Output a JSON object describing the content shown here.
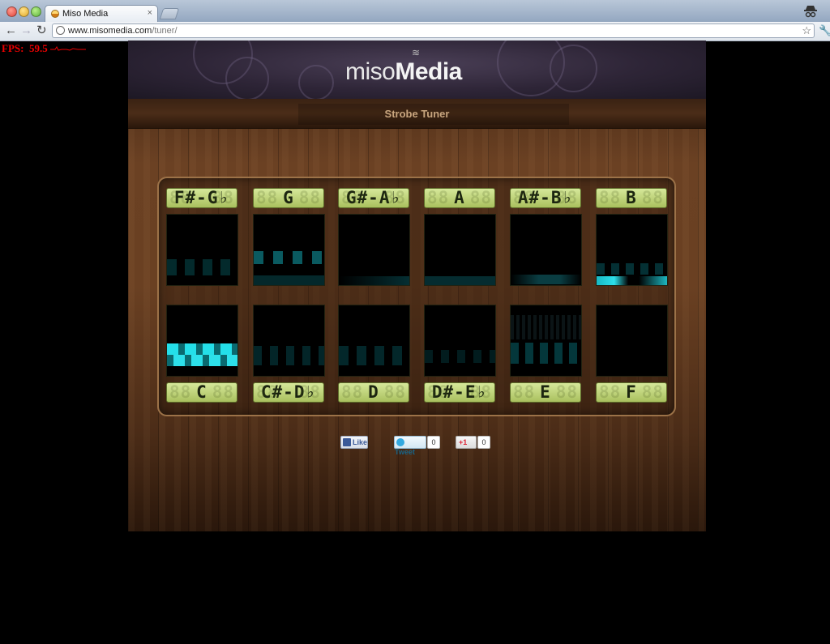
{
  "browser": {
    "tab_title": "Miso Media",
    "tab_close": "×",
    "url_host": "www.misomedia.com",
    "url_path": "/tuner/",
    "back_icon": "←",
    "forward_icon": "→",
    "reload_icon": "↻",
    "star_icon": "☆",
    "wrench_icon": "🔧"
  },
  "fps": {
    "label": "FPS:",
    "value": "59.5"
  },
  "site": {
    "logo_thin": "miso",
    "logo_bold": "Media",
    "subtitle": "Strobe Tuner"
  },
  "tuner": {
    "top_notes": [
      "F#-G♭",
      "G",
      "G#-A♭",
      "A",
      "A#-B♭",
      "B"
    ],
    "bottom_notes": [
      "C",
      "C#-D♭",
      "D",
      "D#-E♭",
      "E",
      "F"
    ],
    "accent_color": "#2de0ea"
  },
  "social": {
    "like_label": "Like",
    "tweet_label": "Tweet",
    "tweet_count": "0",
    "plus_label": "+1",
    "plus_count": "0"
  }
}
